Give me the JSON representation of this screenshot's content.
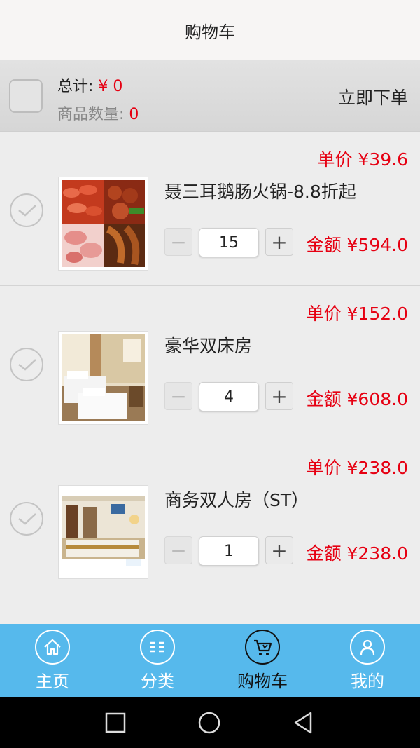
{
  "header": {
    "title": "购物车"
  },
  "summary": {
    "total_label": "总计: ",
    "total_value": "¥ 0",
    "count_label": "商品数量: ",
    "count_value": "0",
    "order_button": "立即下单"
  },
  "items": [
    {
      "name": "聂三耳鹅肠火锅-8.8折起",
      "unit_price": "单价 ¥39.6",
      "quantity": "15",
      "amount": "金额 ¥594.0",
      "image": "food-platter-image"
    },
    {
      "name": "豪华双床房",
      "unit_price": "单价 ¥152.0",
      "quantity": "4",
      "amount": "金额 ¥608.0",
      "image": "twin-room-image"
    },
    {
      "name": "商务双人房（ST）",
      "unit_price": "单价 ¥238.0",
      "quantity": "1",
      "amount": "金额 ¥238.0",
      "image": "business-room-image"
    }
  ],
  "tabs": [
    {
      "label": "主页",
      "icon": "home-icon",
      "active": false
    },
    {
      "label": "分类",
      "icon": "category-icon",
      "active": false
    },
    {
      "label": "购物车",
      "icon": "cart-icon",
      "active": true
    },
    {
      "label": "我的",
      "icon": "user-icon",
      "active": false
    }
  ],
  "colors": {
    "accent_red": "#e60012",
    "tabbar_blue": "#56b9ec"
  },
  "stepper": {
    "minus": "−",
    "plus": "+"
  }
}
